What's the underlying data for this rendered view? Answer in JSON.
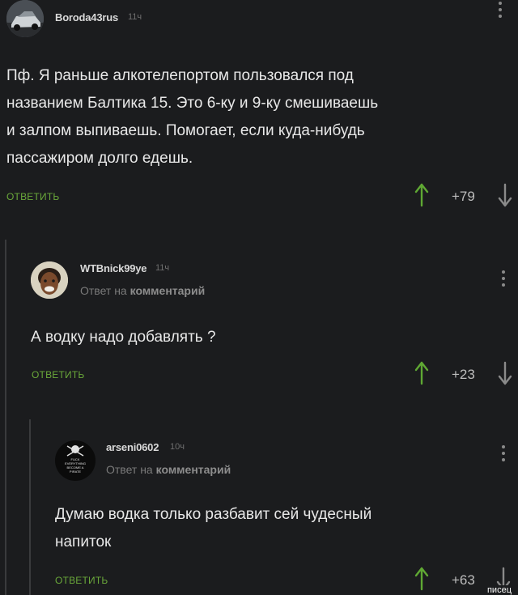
{
  "comments": [
    {
      "username": "Boroda43rus",
      "time": "11ч",
      "reply_to": "",
      "text_lines": [
        "Пф. Я раньше алкотелепортом пользовался под",
        "названием Балтика 15. Это 6-ку и 9-ку смешиваешь",
        "и залпом выпиваешь. Помогает, если куда-нибудь",
        "пассажиром долго едешь."
      ],
      "reply_label": "ОТВЕТИТЬ",
      "score": "+79"
    },
    {
      "username": "WTBnick99ye",
      "time": "11ч",
      "reply_prefix": "Ответ на",
      "reply_target": "комментарий",
      "text_lines": [
        "А водку надо добавлять ?"
      ],
      "reply_label": "ОТВЕТИТЬ",
      "score": "+23"
    },
    {
      "username": "arseni0602",
      "time": "10ч",
      "reply_prefix": "Ответ на",
      "reply_target": "комментарий",
      "avatar_text": [
        "FUCK",
        "EVERYTHING",
        "BECOME A",
        "PIRATE"
      ],
      "text_lines": [
        "Думаю водка только разбавит сей чудесный",
        "напиток"
      ],
      "reply_label": "ОТВЕТИТЬ",
      "score": "+63"
    }
  ],
  "watermark": "писец",
  "colors": {
    "background": "#1b1c1e",
    "reply_green": "#6aa83a",
    "upvote_green": "#5fa833"
  }
}
